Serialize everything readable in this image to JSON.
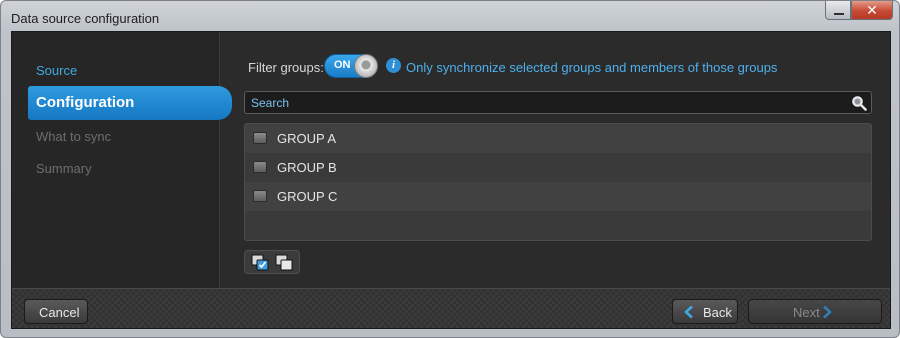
{
  "window": {
    "title": "Data source configuration"
  },
  "sidebar": {
    "items": [
      {
        "label": "Source",
        "state": "done"
      },
      {
        "label": "Configuration",
        "state": "active"
      },
      {
        "label": "What to sync",
        "state": "pending"
      },
      {
        "label": "Summary",
        "state": "pending"
      }
    ]
  },
  "filter": {
    "label": "Filter groups:",
    "toggle_state": "ON",
    "info_text": "Only synchronize selected groups and members of those groups"
  },
  "search": {
    "placeholder": "Search",
    "value": ""
  },
  "groups": [
    {
      "label": "GROUP A",
      "checked": false
    },
    {
      "label": "GROUP B",
      "checked": false
    },
    {
      "label": "GROUP C",
      "checked": false
    }
  ],
  "footer": {
    "cancel_label": "Cancel",
    "back_label": "Back",
    "next_label": "Next"
  },
  "colors": {
    "accent": "#1f8ad6",
    "panel_bg": "#2b2b2b",
    "link_text": "#4eb0ec"
  }
}
